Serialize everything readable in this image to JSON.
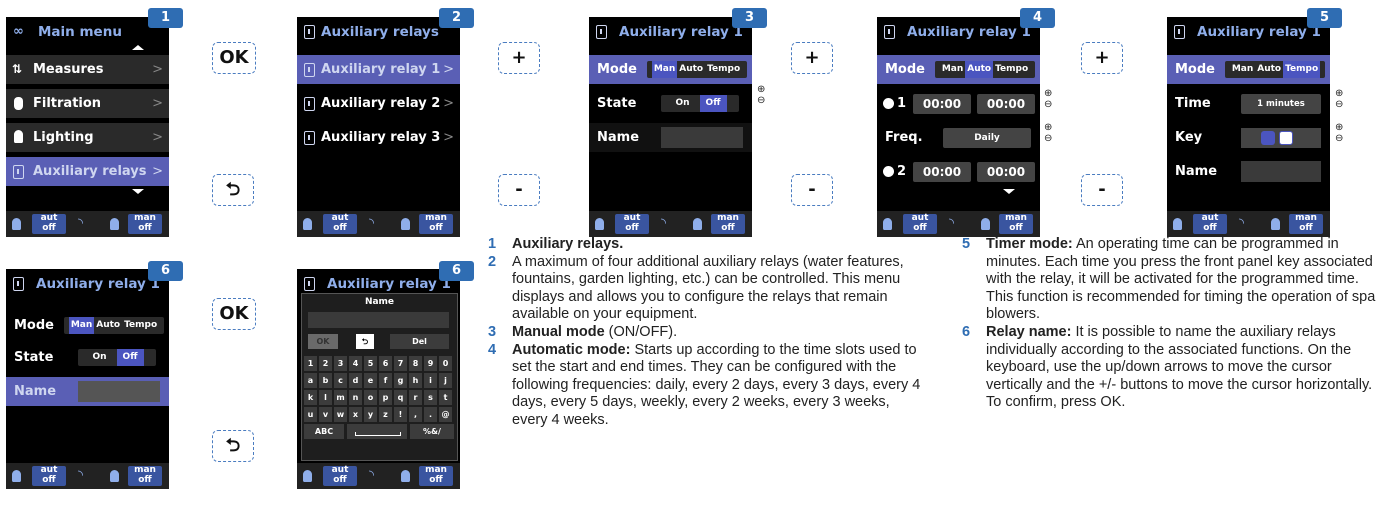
{
  "badges": {
    "s1": "1",
    "s2": "2",
    "s3": "3",
    "s4": "4",
    "s5": "5",
    "s6": "6",
    "s7": "6"
  },
  "buttons": {
    "ok": "OK",
    "plus": "+",
    "minus": "-",
    "back": "⮌"
  },
  "pm": "+\n−",
  "footer": {
    "aut": "aut",
    "off": "off",
    "man": "man"
  },
  "screen1": {
    "title": "Main menu",
    "items": [
      {
        "label": "Measures"
      },
      {
        "label": "Filtration"
      },
      {
        "label": "Lighting"
      },
      {
        "label": "Auxiliary relays"
      }
    ]
  },
  "screen2": {
    "title": "Auxiliary relays",
    "items": [
      {
        "label": "Auxiliary relay 1"
      },
      {
        "label": "Auxiliary relay 2"
      },
      {
        "label": "Auxiliary relay 3"
      }
    ]
  },
  "screen3": {
    "title": "Auxiliary relay 1",
    "mode_label": "Mode",
    "state_label": "State",
    "name_label": "Name",
    "mode_options": [
      "Man",
      "Auto",
      "Tempo"
    ],
    "state_options": [
      "On",
      "Off"
    ]
  },
  "screen4": {
    "title": "Auxiliary relay 1",
    "mode_label": "Mode",
    "mode_options": [
      "Man",
      "Auto",
      "Tempo"
    ],
    "slot1": "1",
    "slot2": "2",
    "time": "00:00",
    "freq_label": "Freq.",
    "freq_value": "Daily"
  },
  "screen5": {
    "title": "Auxiliary relay 1",
    "mode_label": "Mode",
    "mode_options": [
      "Man",
      "Auto",
      "Tempo"
    ],
    "time_label": "Time",
    "time_value": "1 minutes",
    "key_label": "Key",
    "name_label": "Name"
  },
  "screen6": {
    "title": "Auxiliary relay 1",
    "mode_label": "Mode",
    "state_label": "State",
    "name_label": "Name",
    "mode_options": [
      "Man",
      "Auto",
      "Tempo"
    ],
    "state_options": [
      "On",
      "Off"
    ]
  },
  "screen7": {
    "title": "Auxiliary relay 1",
    "kb_title": "Name",
    "ok": "OK",
    "back": "⮌",
    "del": "Del",
    "row1": [
      "1",
      "2",
      "3",
      "4",
      "5",
      "6",
      "7",
      "8",
      "9",
      "0"
    ],
    "row2": [
      "a",
      "b",
      "c",
      "d",
      "e",
      "f",
      "g",
      "h",
      "i",
      "j"
    ],
    "row3": [
      "k",
      "l",
      "m",
      "n",
      "o",
      "p",
      "q",
      "r",
      "s",
      "t"
    ],
    "row4": [
      "u",
      "v",
      "w",
      "x",
      "y",
      "z",
      "!",
      ",",
      ".",
      "@"
    ],
    "abc": "ABC",
    "sym": "%&/"
  },
  "descriptions": {
    "n1": "1",
    "n2": "2",
    "n3": "3",
    "n4": "4",
    "n5": "5",
    "n6": "6",
    "d1_title": "Auxiliary relays.",
    "d2": "A maximum of four additional auxiliary relays (water features, fountains, garden lighting, etc.) can be controlled. This menu displays and allows you to configure the relays that remain available on your equipment.",
    "d3_title": "Manual mode",
    "d3_rest": " (ON/OFF).",
    "d4_title": "Automatic mode:",
    "d4_rest": " Starts up according to the time slots used to set the start and end times. They can be configured with the following frequencies: daily, every 2 days, every 3 days, every 4 days, every 5 days, weekly, every 2 weeks, every 3 weeks, every 4 weeks.",
    "d5_title": "Timer mode:",
    "d5_rest": " An operating time can be programmed in minutes. Each time you press the front panel key associated with the relay, it will be activated for the programmed time. This function is recommended for timing the operation of spa blowers.",
    "d6_title": "Relay name:",
    "d6_rest": " It is possible to name the auxiliary relays individually according to the associated functions. On the keyboard, use the up/down arrows to move the cursor vertically and the +/- buttons to move the cursor horizontally. To confirm, press OK."
  }
}
